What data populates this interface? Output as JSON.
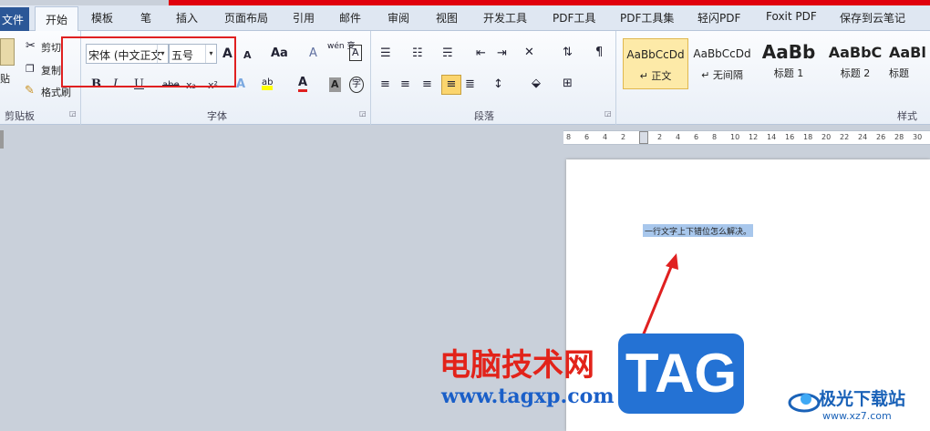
{
  "tabs": {
    "file": "文件",
    "active": "开始",
    "items": [
      "模板",
      "笔",
      "插入",
      "页面布局",
      "引用",
      "邮件",
      "审阅",
      "视图",
      "开发工具",
      "PDF工具",
      "PDF工具集",
      "轻闪PDF",
      "Foxit PDF",
      "保存到云笔记"
    ]
  },
  "clipboard": {
    "paste": "贴",
    "cut": "剪切",
    "copy": "复制",
    "format_painter": "格式刷",
    "label": "剪贴板"
  },
  "font": {
    "family": "宋体 (中文正文",
    "size": "五号",
    "label": "字体",
    "grow": "A",
    "shrink": "A",
    "case": "Aa",
    "clear": "A",
    "phonetic": "wén 变",
    "border": "A",
    "bold": "B",
    "italic": "I",
    "underline": "U",
    "strike": "abe",
    "sub": "x₂",
    "sup": "x²",
    "effects": "A",
    "highlight": "ab",
    "color": "A",
    "shade": "A",
    "enclose": "字"
  },
  "paragraph": {
    "label": "段落"
  },
  "styles": {
    "label": "样式",
    "items": [
      {
        "preview": "AaBbCcDd",
        "name": "↵ 正文"
      },
      {
        "preview": "AaBbCcDd",
        "name": "↵ 无间隔"
      },
      {
        "preview": "AaBb",
        "name": "标题 1"
      },
      {
        "preview": "AaBbC",
        "name": "标题 2"
      },
      {
        "preview": "AaBl",
        "name": "标题"
      }
    ]
  },
  "ruler": {
    "ticks": [
      "8",
      "6",
      "4",
      "2",
      "",
      "2",
      "4",
      "6",
      "8",
      "10",
      "12",
      "14",
      "16",
      "18",
      "20",
      "22",
      "24",
      "26",
      "28",
      "30"
    ]
  },
  "document": {
    "selected_text": "一行文字上下错位怎么解决。"
  },
  "watermark": {
    "cn": "电脑技术网",
    "url": "www.tagxp.com",
    "tag": "TAG",
    "jg_name": "极光下载站",
    "jg_url": "www.xz7.com"
  },
  "colors": {
    "accent": "#2b5797",
    "highlight": "#ffff00",
    "font_color": "#e02020",
    "annotation": "#e02020"
  }
}
